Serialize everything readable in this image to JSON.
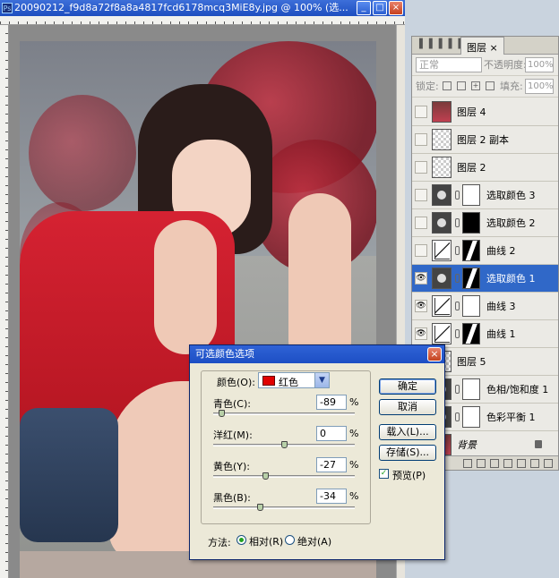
{
  "document": {
    "title": "20090212_f9d8a72f8a8a4817fcd6178mcq3MiE8y.jpg @ 100% (选...",
    "ps_icon": "Ps"
  },
  "window_buttons": {
    "minimize": "_",
    "maximize": "□",
    "close": "×"
  },
  "layers_panel": {
    "tab_label": "图层",
    "tab_close": "×",
    "blend_mode": "正常",
    "opacity_label": "不透明度:",
    "opacity_value": "100%",
    "lock_label": "锁定:",
    "fill_label": "填充:",
    "fill_value": "100%",
    "layers": [
      {
        "name": "图层 4",
        "visible": false,
        "thumb": "photo",
        "mask": "none"
      },
      {
        "name": "图层 2 副本",
        "visible": false,
        "thumb": "checker",
        "mask": "none"
      },
      {
        "name": "图层 2",
        "visible": false,
        "thumb": "checker",
        "mask": "none"
      },
      {
        "name": "选取颜色 3",
        "visible": false,
        "thumb": "adj",
        "mask": "white"
      },
      {
        "name": "选取颜色 2",
        "visible": false,
        "thumb": "adj",
        "mask": "black"
      },
      {
        "name": "曲线 2",
        "visible": false,
        "thumb": "curve",
        "mask": "shape"
      },
      {
        "name": "选取颜色 1",
        "visible": true,
        "thumb": "adj",
        "mask": "shape",
        "selected": true
      },
      {
        "name": "曲线 3",
        "visible": true,
        "thumb": "curve",
        "mask": "white"
      },
      {
        "name": "曲线 1",
        "visible": true,
        "thumb": "curve",
        "mask": "shape"
      },
      {
        "name": "图层 5",
        "visible": true,
        "thumb": "checker",
        "mask": "none"
      },
      {
        "name": "色相/饱和度 1",
        "visible": true,
        "thumb": "adj",
        "mask": "white"
      },
      {
        "name": "色彩平衡 1",
        "visible": true,
        "thumb": "adj",
        "mask": "white"
      },
      {
        "name": "背景",
        "visible": true,
        "thumb": "photo",
        "mask": "none",
        "locked": true
      }
    ],
    "eye_glyph": "👁"
  },
  "dialog": {
    "title": "可选颜色选项",
    "close": "×",
    "color_label": "颜色(O):",
    "color_value": "红色",
    "color_swatch": "#e00000",
    "dropdown_arrow": "▼",
    "sliders": [
      {
        "label": "青色(C):",
        "value": "-89",
        "position": -89
      },
      {
        "label": "洋红(M):",
        "value": "0",
        "position": 0
      },
      {
        "label": "黄色(Y):",
        "value": "-27",
        "position": -27
      },
      {
        "label": "黑色(B):",
        "value": "-34",
        "position": -34
      }
    ],
    "percent": "%",
    "buttons": {
      "ok": "确定",
      "cancel": "取消",
      "load": "载入(L)...",
      "save": "存储(S)..."
    },
    "preview_label": "预览(P)",
    "preview_checked": true,
    "check_glyph": "✓",
    "method_label": "方法:",
    "methods": [
      {
        "label": "相对(R)",
        "selected": true
      },
      {
        "label": "绝对(A)",
        "selected": false
      }
    ]
  }
}
